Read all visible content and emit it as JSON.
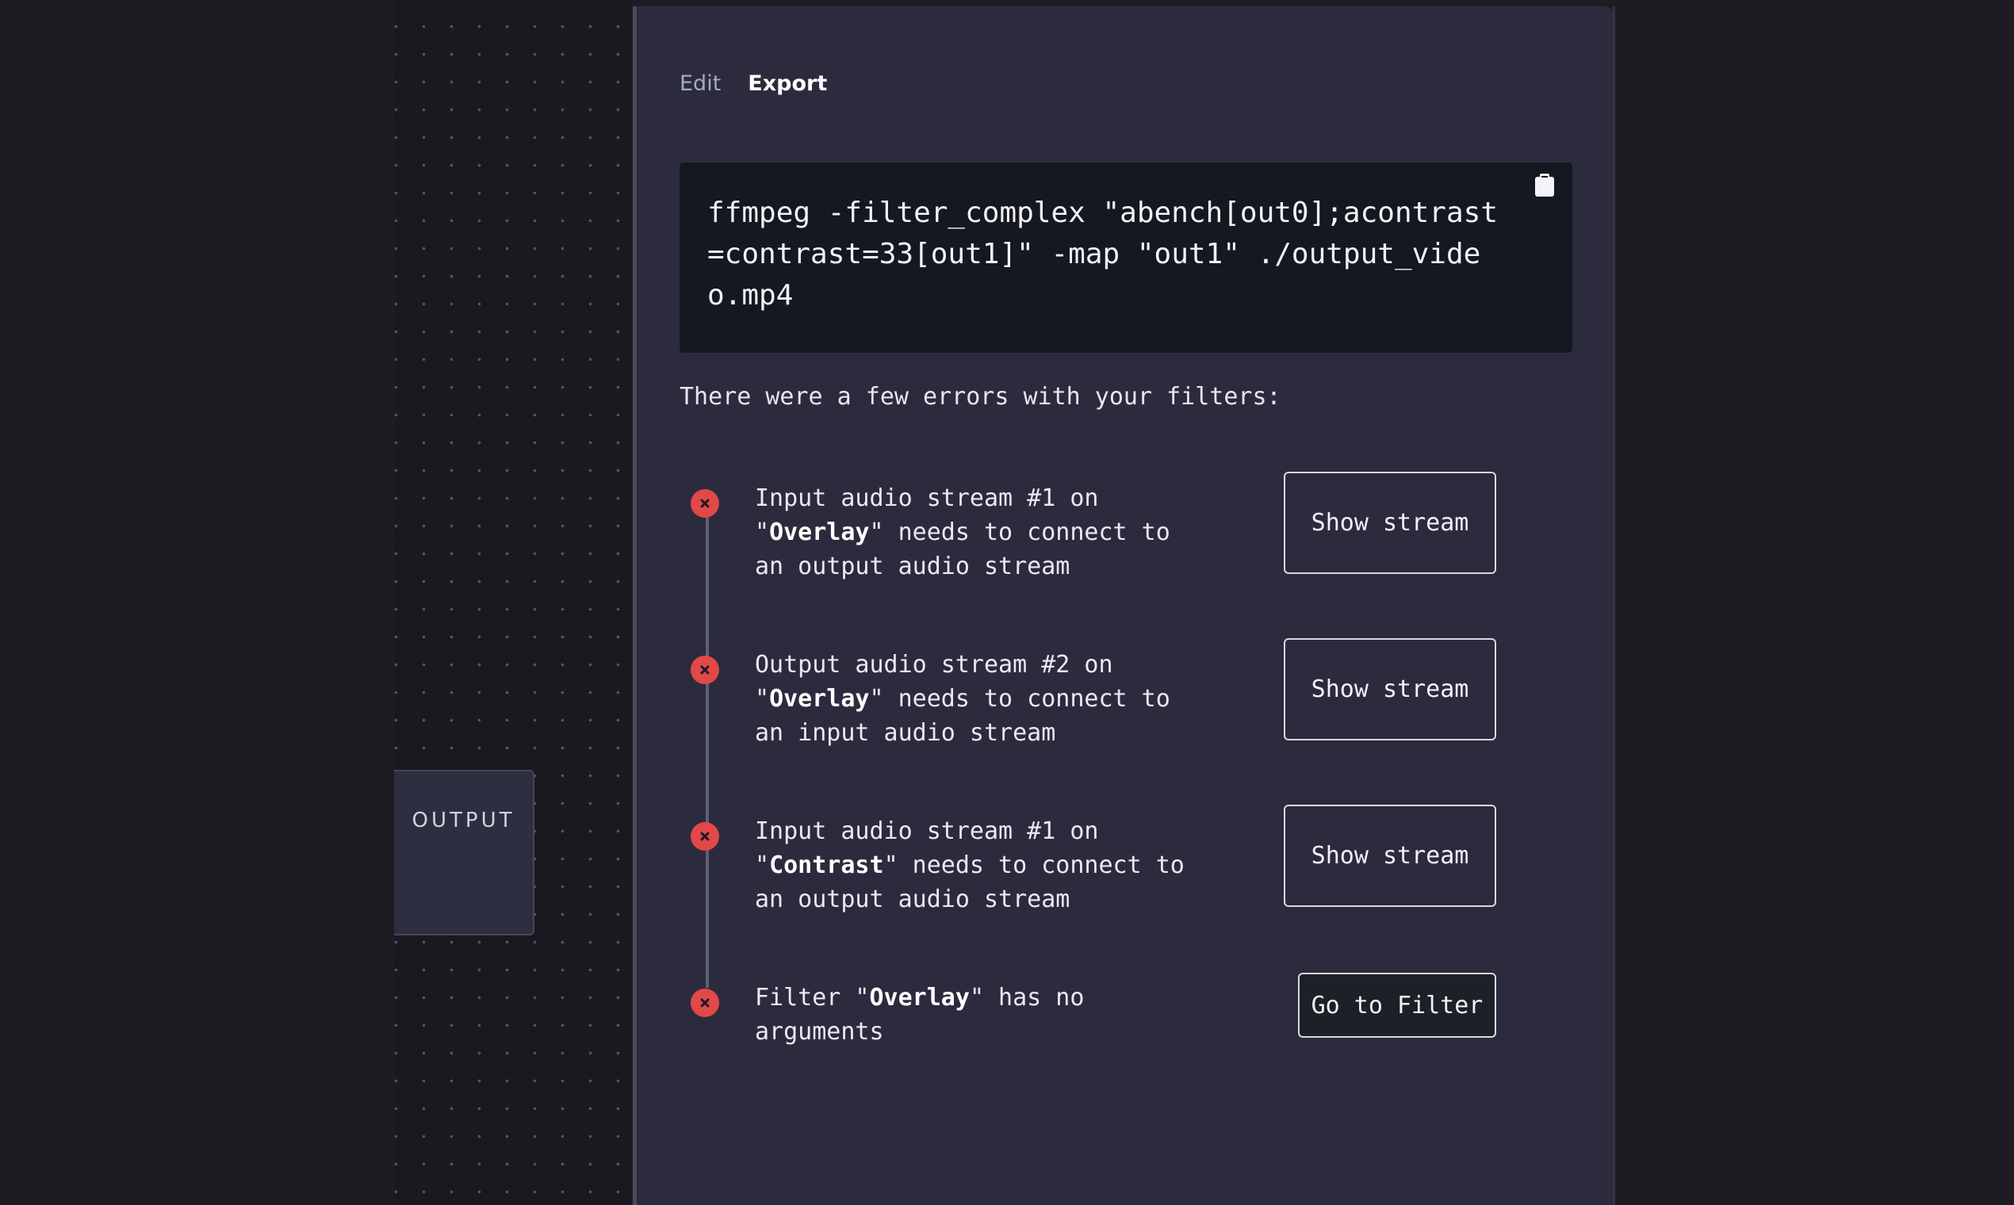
{
  "canvas": {
    "output_node_label": "OUTPUT"
  },
  "panel": {
    "tabs": [
      {
        "label": "Edit",
        "active": false
      },
      {
        "label": "Export",
        "active": true
      }
    ],
    "command": "ffmpeg -filter_complex \"abench[out0];acontrast=contrast=33[out1]\" -map \"out1\" ./output_video.mp4",
    "copy_icon": "clipboard-icon",
    "errors_heading": "There were a few errors with your filters:",
    "errors": [
      {
        "pre": "Input audio stream #1 on \"",
        "filter": "Overlay",
        "post": "\" needs to connect to an output audio stream",
        "action": "Show stream"
      },
      {
        "pre": "Output audio stream #2 on \"",
        "filter": "Overlay",
        "post": "\" needs to connect to an input audio stream",
        "action": "Show stream"
      },
      {
        "pre": "Input audio stream #1 on \"",
        "filter": "Contrast",
        "post": "\" needs to connect to an output audio stream",
        "action": "Show stream"
      },
      {
        "pre": "Filter \"",
        "filter": "Overlay",
        "post": "\" has no arguments",
        "action": "Go to Filter"
      }
    ],
    "colors": {
      "panel_bg": "#2c2b3e",
      "code_bg": "#151820",
      "error_red": "#e34848",
      "canvas_bg": "#1a1920"
    }
  }
}
